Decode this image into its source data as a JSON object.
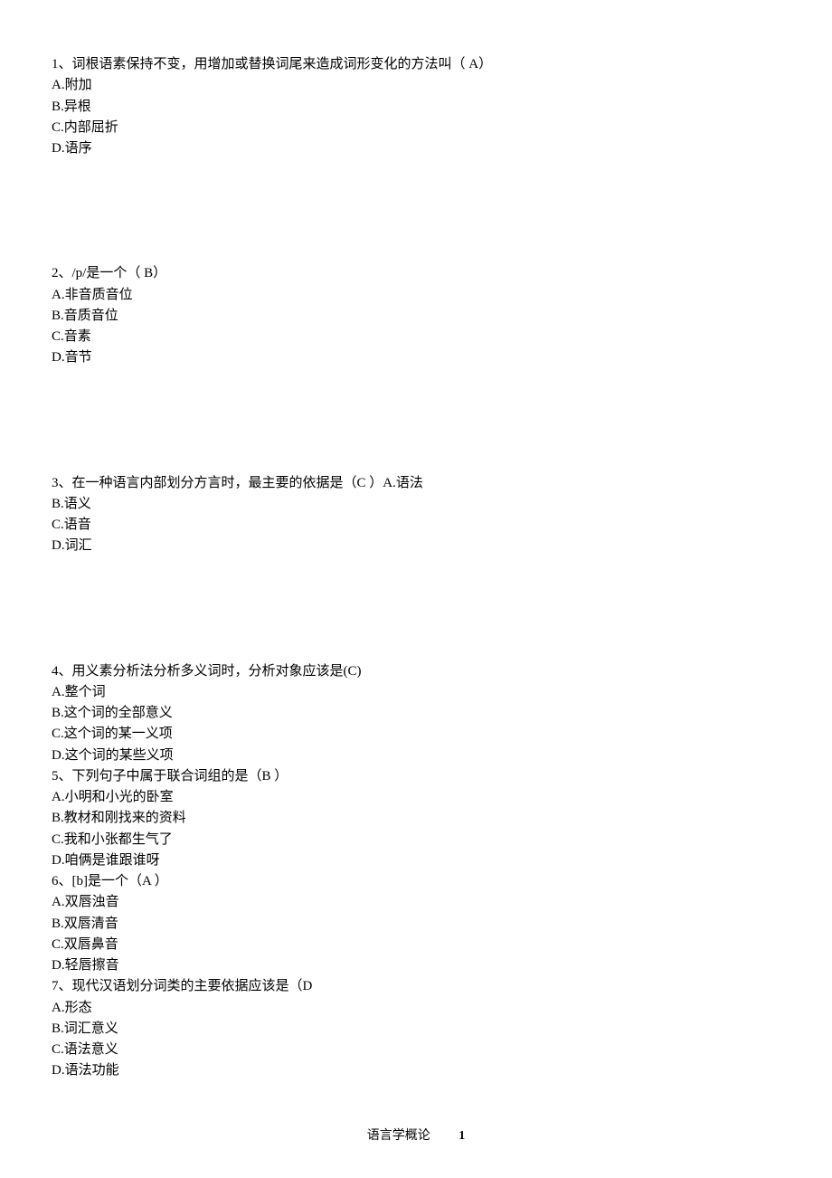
{
  "questions": [
    {
      "stem": "1、词根语素保持不变，用增加或替换词尾来造成词形变化的方法叫（ A）",
      "options": [
        "A.附加",
        "B.异根",
        "C.内部屈折",
        "D.语序"
      ],
      "gapAfter": true
    },
    {
      "stem": "2、/p/是一个（ B）",
      "options": [
        "A.非音质音位",
        "B.音质音位",
        "C.音素",
        "D.音节"
      ],
      "gapAfter": true
    },
    {
      "stem": "3、在一种语言内部划分方言时，最主要的依据是（C ）A.语法",
      "options": [
        "B.语义",
        "C.语音",
        "D.词汇"
      ],
      "gapAfter": true
    },
    {
      "stem": "4、用义素分析法分析多义词时，分析对象应该是(C)",
      "options": [
        "A.整个词",
        "B.这个词的全部意义",
        "C.这个词的某一义项",
        "D.这个词的某些义项"
      ],
      "gapAfter": false
    },
    {
      "stem": "5、下列句子中属于联合词组的是（B ）",
      "options": [
        "A.小明和小光的卧室",
        "B.教材和刚找来的资料",
        "C.我和小张都生气了",
        "D.咱俩是谁跟谁呀"
      ],
      "gapAfter": false
    },
    {
      "stem": "6、[b]是一个（A ）",
      "options": [
        "A.双唇浊音",
        "B.双唇清音",
        "C.双唇鼻音",
        "D.轻唇擦音"
      ],
      "gapAfter": false
    },
    {
      "stem": "7、现代汉语划分词类的主要依据应该是（D",
      "options": [
        "A.形态",
        "B.词汇意义",
        "C.语法意义",
        "D.语法功能"
      ],
      "gapAfter": false
    }
  ],
  "footer": {
    "title": "语言学概论",
    "page": "1"
  }
}
